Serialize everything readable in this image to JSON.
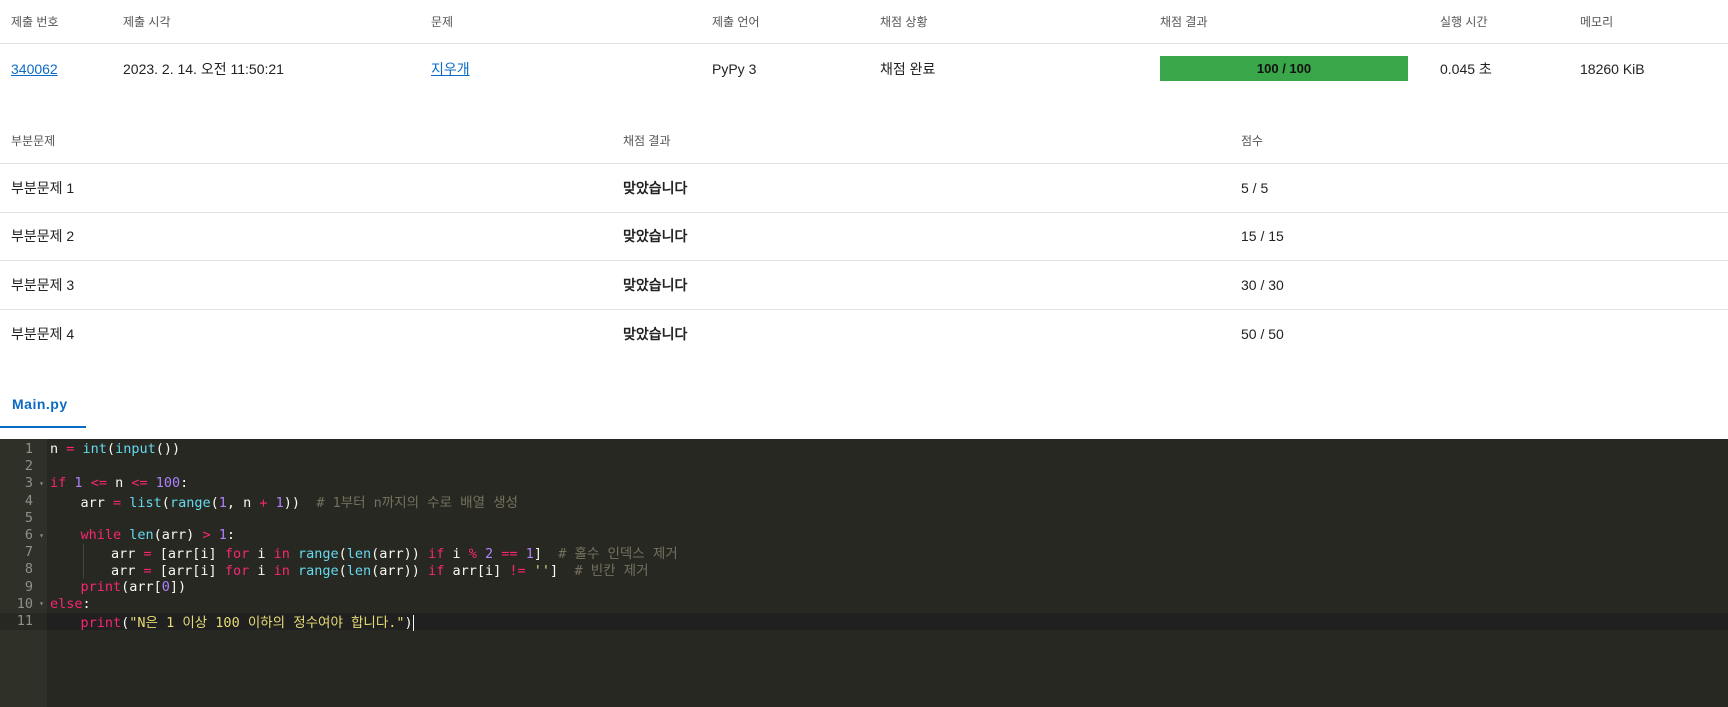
{
  "submission": {
    "headers": [
      "제출 번호",
      "제출 시각",
      "문제",
      "제출 언어",
      "채점 상황",
      "채점 결과",
      "실행 시간",
      "메모리"
    ],
    "row": {
      "id": "340062",
      "time": "2023. 2. 14. 오전 11:50:21",
      "problem": "지우개",
      "language": "PyPy 3",
      "status": "채점 완료",
      "result": "100 / 100",
      "runtime": "0.045 초",
      "memory": "18260 KiB"
    },
    "result_color": "#3aa64a"
  },
  "subtasks": {
    "headers": [
      "부분문제",
      "채점 결과",
      "점수"
    ],
    "rows": [
      {
        "name": "부분문제 1",
        "result": "맞았습니다",
        "score": "5 / 5"
      },
      {
        "name": "부분문제 2",
        "result": "맞았습니다",
        "score": "15 / 15"
      },
      {
        "name": "부분문제 3",
        "result": "맞았습니다",
        "score": "30 / 30"
      },
      {
        "name": "부분문제 4",
        "result": "맞았습니다",
        "score": "50 / 50"
      }
    ],
    "ok_color": "#0b9e4a"
  },
  "file_tab": {
    "label": "Main.py"
  },
  "editor": {
    "theme_bg": "#272822",
    "active_line": 11,
    "lines": [
      {
        "n": "1",
        "fold": false,
        "indent": 0,
        "tokens": [
          [
            "n",
            ""
          ],
          [
            " = ",
            "op"
          ],
          [
            "int",
            "fn"
          ],
          [
            "(",
            ""
          ],
          [
            "input",
            "fn"
          ],
          [
            "())",
            ""
          ]
        ]
      },
      {
        "n": "2",
        "fold": false,
        "indent": 0,
        "tokens": []
      },
      {
        "n": "3",
        "fold": true,
        "indent": 0,
        "tokens": [
          [
            "if",
            "kw"
          ],
          [
            " ",
            ""
          ],
          [
            "1",
            "num"
          ],
          [
            " ",
            ""
          ],
          [
            "<=",
            "op"
          ],
          [
            " n ",
            ""
          ],
          [
            "<=",
            "op"
          ],
          [
            " ",
            ""
          ],
          [
            "100",
            "num"
          ],
          [
            ":",
            ""
          ]
        ]
      },
      {
        "n": "4",
        "fold": false,
        "indent": 1,
        "tokens": [
          [
            "arr",
            ""
          ],
          [
            " = ",
            "op"
          ],
          [
            "list",
            "fn"
          ],
          [
            "(",
            ""
          ],
          [
            "range",
            "fn"
          ],
          [
            "(",
            ""
          ],
          [
            "1",
            "num"
          ],
          [
            ", n ",
            ""
          ],
          [
            "+",
            "op"
          ],
          [
            " ",
            ""
          ],
          [
            "1",
            "num"
          ],
          [
            "))",
            ""
          ],
          [
            "  # 1부터 n까지의 수로 배열 생성",
            "cm"
          ]
        ]
      },
      {
        "n": "5",
        "fold": false,
        "indent": 0,
        "tokens": []
      },
      {
        "n": "6",
        "fold": true,
        "indent": 1,
        "tokens": [
          [
            "while",
            "kw"
          ],
          [
            " ",
            ""
          ],
          [
            "len",
            "fn"
          ],
          [
            "(arr) ",
            ""
          ],
          [
            ">",
            "op"
          ],
          [
            " ",
            ""
          ],
          [
            "1",
            "num"
          ],
          [
            ":",
            ""
          ]
        ]
      },
      {
        "n": "7",
        "fold": false,
        "indent": 2,
        "tokens": [
          [
            "arr",
            ""
          ],
          [
            " = ",
            "op"
          ],
          [
            "[arr[i] ",
            ""
          ],
          [
            "for",
            "kw"
          ],
          [
            " i ",
            ""
          ],
          [
            "in",
            "kw"
          ],
          [
            " ",
            ""
          ],
          [
            "range",
            "fn"
          ],
          [
            "(",
            ""
          ],
          [
            "len",
            "fn"
          ],
          [
            "(arr)) ",
            ""
          ],
          [
            "if",
            "kw"
          ],
          [
            " i ",
            ""
          ],
          [
            "%",
            "op"
          ],
          [
            " ",
            ""
          ],
          [
            "2",
            "num"
          ],
          [
            " ",
            ""
          ],
          [
            "==",
            "op"
          ],
          [
            " ",
            ""
          ],
          [
            "1",
            "num"
          ],
          [
            "]",
            ""
          ],
          [
            "  # 홀수 인덱스 제거",
            "cm"
          ]
        ]
      },
      {
        "n": "8",
        "fold": false,
        "indent": 2,
        "tokens": [
          [
            "arr",
            ""
          ],
          [
            " = ",
            "op"
          ],
          [
            "[arr[i] ",
            ""
          ],
          [
            "for",
            "kw"
          ],
          [
            " i ",
            ""
          ],
          [
            "in",
            "kw"
          ],
          [
            " ",
            ""
          ],
          [
            "range",
            "fn"
          ],
          [
            "(",
            ""
          ],
          [
            "len",
            "fn"
          ],
          [
            "(arr)) ",
            ""
          ],
          [
            "if",
            "kw"
          ],
          [
            " arr[i] ",
            ""
          ],
          [
            "!=",
            "op"
          ],
          [
            " ",
            ""
          ],
          [
            "''",
            "str"
          ],
          [
            "]",
            ""
          ],
          [
            "  # 빈칸 제거",
            "cm"
          ]
        ]
      },
      {
        "n": "9",
        "fold": false,
        "indent": 1,
        "tokens": [
          [
            "print",
            "kw"
          ],
          [
            "(arr[",
            ""
          ],
          [
            "0",
            "num"
          ],
          [
            "])",
            ""
          ]
        ]
      },
      {
        "n": "10",
        "fold": true,
        "indent": 0,
        "tokens": [
          [
            "else",
            "kw"
          ],
          [
            ":",
            ""
          ]
        ]
      },
      {
        "n": "11",
        "fold": false,
        "indent": 1,
        "tokens": [
          [
            "print",
            "kw"
          ],
          [
            "(",
            ""
          ],
          [
            "\"N은 1 이상 100 이하의 정수여야 합니다.\"",
            "str"
          ],
          [
            ")",
            ""
          ]
        ]
      }
    ]
  }
}
